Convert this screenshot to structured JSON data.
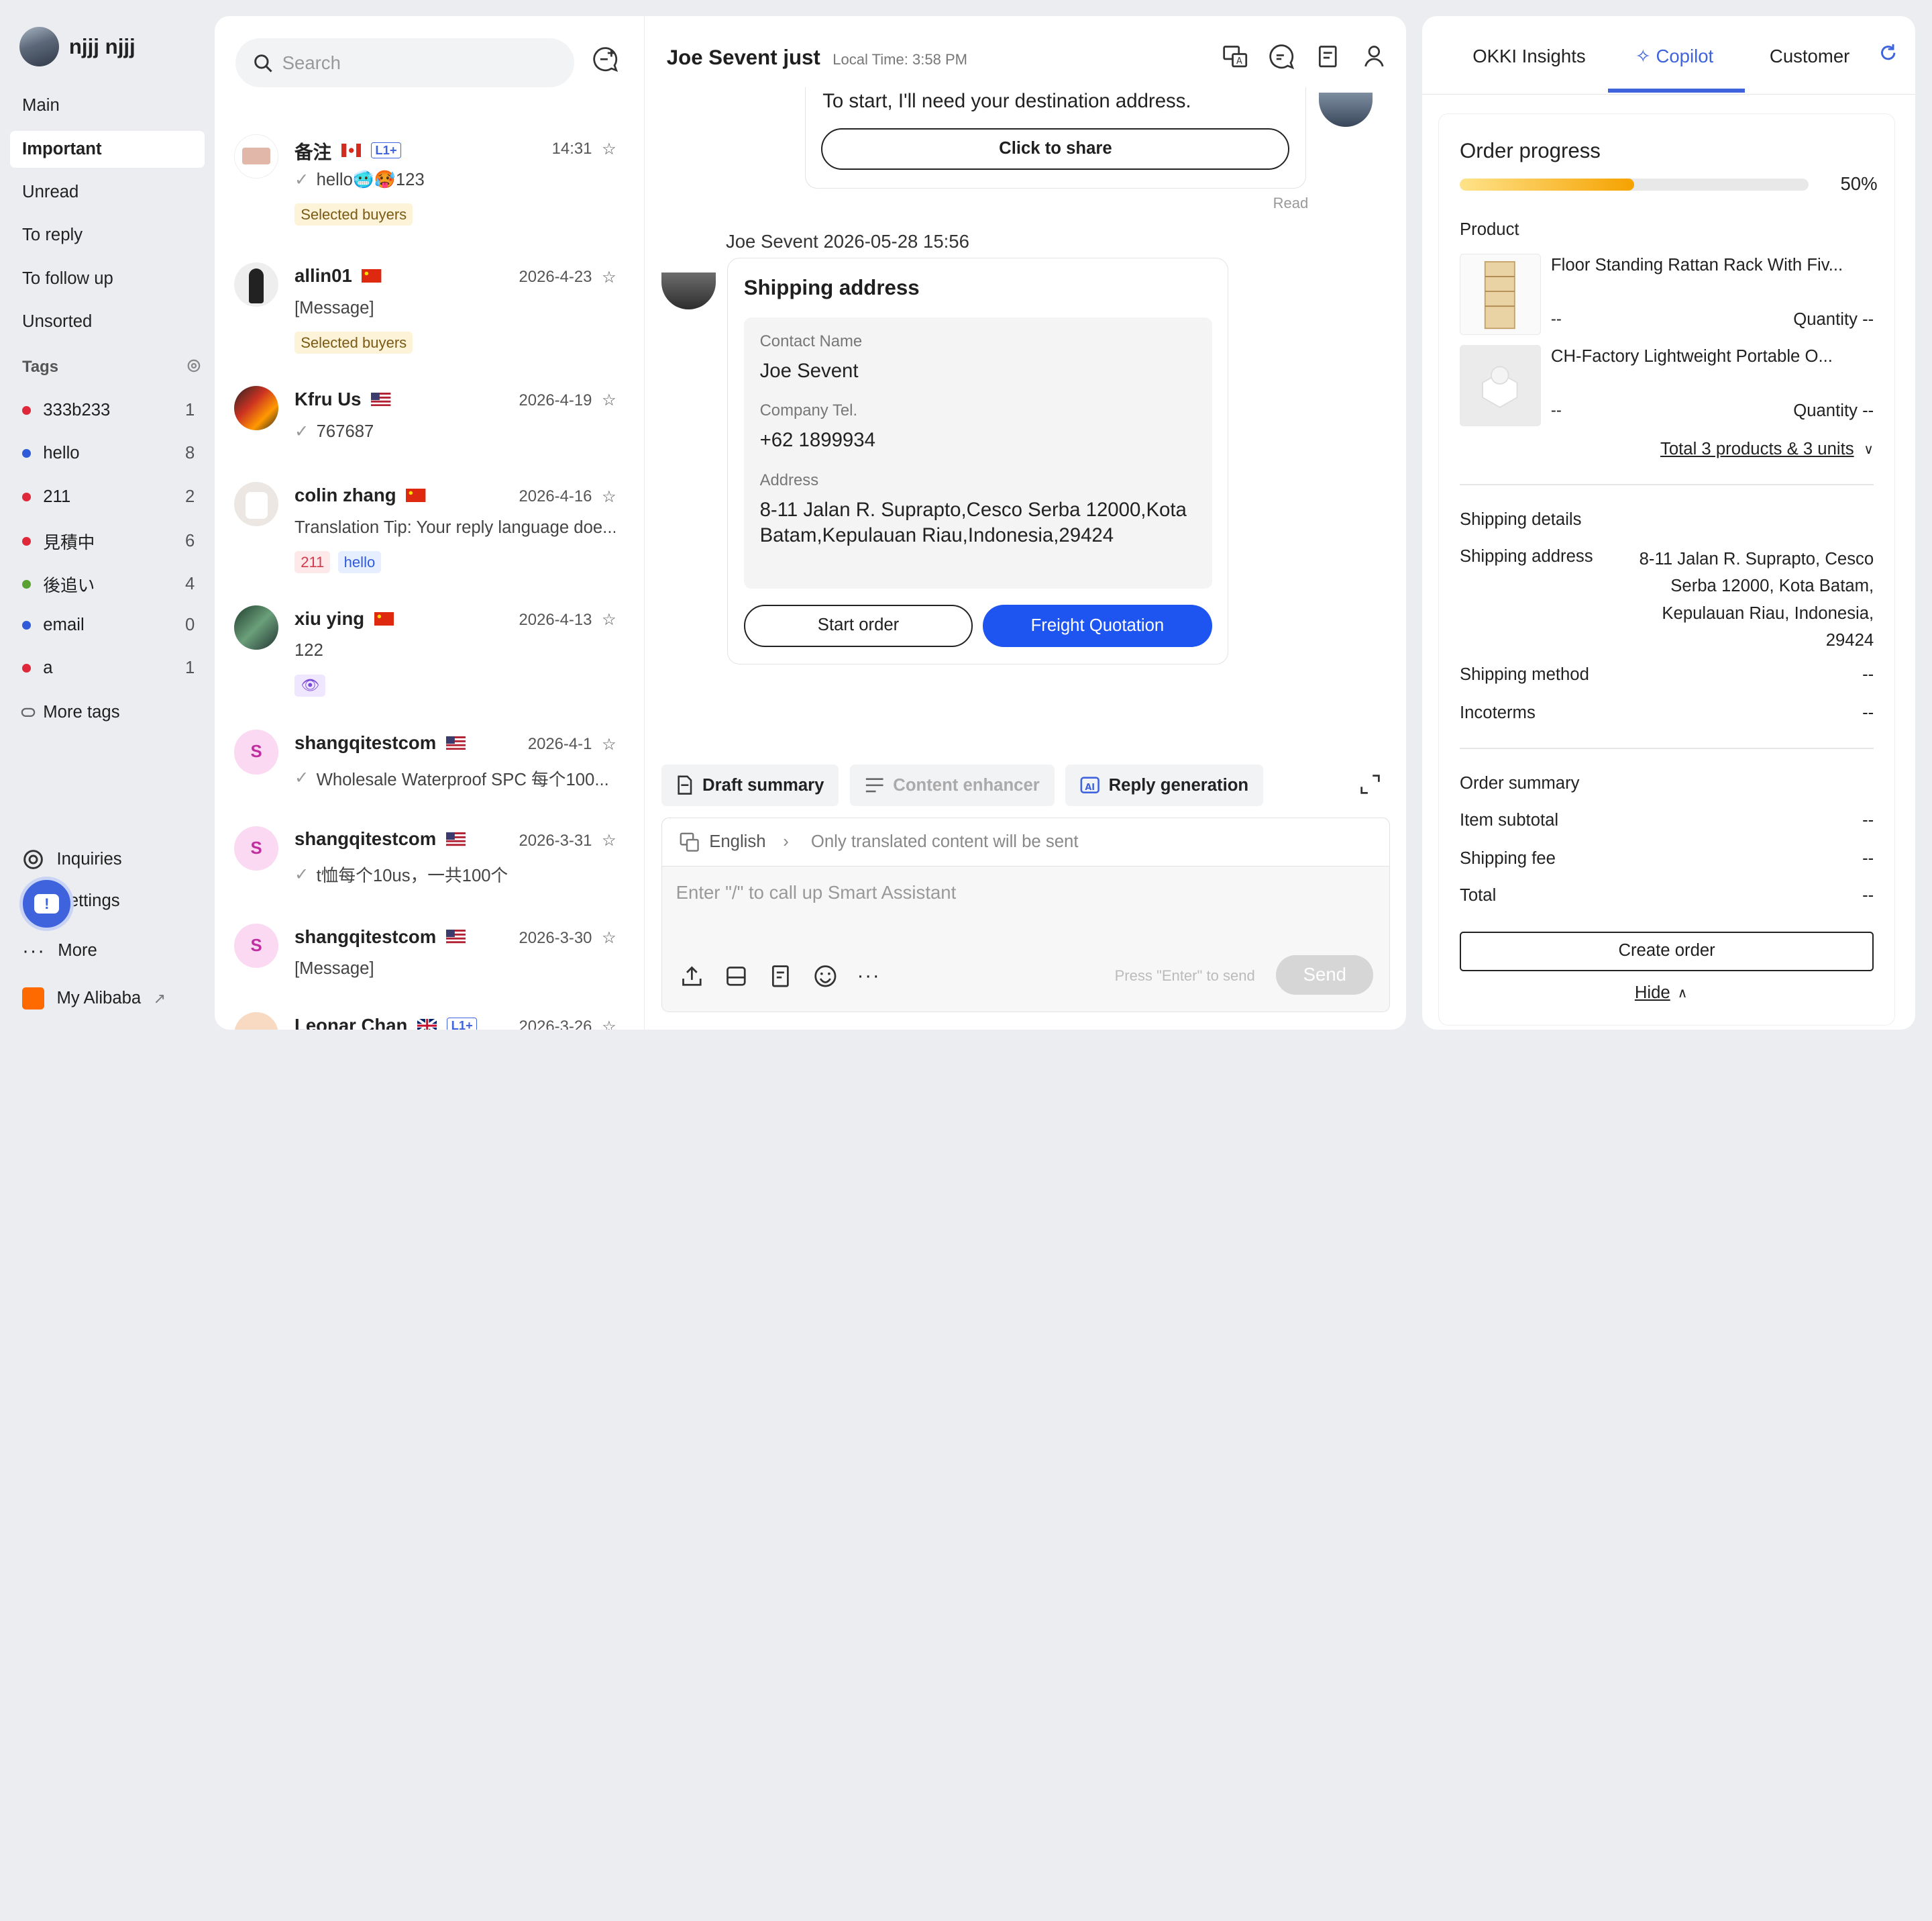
{
  "user": {
    "name": "njjj njjj"
  },
  "nav": {
    "items": [
      {
        "label": "Main",
        "active": false
      },
      {
        "label": "Important",
        "active": true
      },
      {
        "label": "Unread",
        "active": false
      },
      {
        "label": "To reply",
        "active": false
      },
      {
        "label": "To follow up",
        "active": false
      },
      {
        "label": "Unsorted",
        "active": false
      }
    ],
    "tags_title": "Tags",
    "tags": [
      {
        "label": "333b233",
        "count": "1",
        "color": "#e0283b"
      },
      {
        "label": "hello",
        "count": "8",
        "color": "#2f5bd8"
      },
      {
        "label": "211",
        "count": "2",
        "color": "#e0283b"
      },
      {
        "label": "見積中",
        "count": "6",
        "color": "#e0283b"
      },
      {
        "label": "後追い",
        "count": "4",
        "color": "#5aa132"
      },
      {
        "label": "email",
        "count": "0",
        "color": "#2f5bd8"
      },
      {
        "label": "a",
        "count": "1",
        "color": "#e0283b"
      }
    ],
    "more_tags": "More tags",
    "inquiries": "Inquiries",
    "settings": "ettings",
    "more": "More",
    "my_alibaba": "My Alibaba"
  },
  "conversations": {
    "search_placeholder": "Search",
    "items": [
      {
        "name": "备注",
        "flag": "ca",
        "level": "L1+",
        "time": "14:31",
        "message": "hello🥶🥵123",
        "read": true,
        "chips": [
          {
            "text": "Selected buyers",
            "kind": "sel"
          }
        ]
      },
      {
        "name": "allin01",
        "flag": "cn",
        "level": "",
        "time": "2026-4-23",
        "message": "[Message]",
        "read": false,
        "chips": [
          {
            "text": "Selected buyers",
            "kind": "sel"
          }
        ]
      },
      {
        "name": "Kfru Us",
        "flag": "us",
        "level": "",
        "time": "2026-4-19",
        "message": "767687",
        "read": true,
        "chips": []
      },
      {
        "name": "colin zhang",
        "flag": "cn",
        "level": "",
        "time": "2026-4-16",
        "message": "Translation Tip: Your reply language doe...",
        "read": false,
        "chips": [
          {
            "text": "211",
            "kind": "red"
          },
          {
            "text": "hello",
            "kind": "blue"
          }
        ]
      },
      {
        "name": "xiu ying",
        "flag": "cn",
        "level": "",
        "time": "2026-4-13",
        "message": "122",
        "read": false,
        "chips": []
      },
      {
        "name": "shangqitestcom",
        "flag": "us",
        "level": "",
        "time": "2026-4-1",
        "message": "Wholesale Waterproof SPC 每个100...",
        "read": true,
        "chips": []
      },
      {
        "name": "shangqitestcom",
        "flag": "us",
        "level": "",
        "time": "2026-3-31",
        "message": "t恤每个10us，一共100个",
        "read": true,
        "chips": []
      },
      {
        "name": "shangqitestcom",
        "flag": "us",
        "level": "",
        "time": "2026-3-30",
        "message": "[Message]",
        "read": false,
        "chips": []
      },
      {
        "name": "Leonar Chan",
        "flag": "gb",
        "level": "L1+",
        "time": "2026-3-26",
        "message": "",
        "read": false,
        "chips": []
      }
    ]
  },
  "chat": {
    "title": "Joe Sevent just",
    "local_time": "Local Time: 3:58 PM",
    "prev_message": "To start, I'll need your destination address.",
    "share_button": "Click to share",
    "read_status": "Read",
    "sender_line": "Joe Sevent   2026-05-28 15:56",
    "card": {
      "title": "Shipping address",
      "contact_label": "Contact Name",
      "contact_value": "Joe Sevent",
      "tel_label": "Company Tel.",
      "tel_value": "+62 1899934",
      "address_label": "Address",
      "address_value": "8-11 Jalan R. Suprapto,Cesco Serba 12000,Kota Batam,Kepulauan Riau,Indonesia,29424",
      "start_order": "Start order",
      "freight_quotation": "Freight Quotation"
    },
    "tools": {
      "draft_summary": "Draft summary",
      "content_enhancer": "Content enhancer",
      "reply_generation": "Reply generation"
    },
    "composer": {
      "language": "English",
      "translate_note": "Only translated content will be sent",
      "placeholder": "Enter \"/\" to call up Smart Assistant",
      "send_hint": "Press \"Enter\" to send",
      "send": "Send"
    }
  },
  "right_panel": {
    "tabs": [
      {
        "label": "OKKI Insights",
        "active": false
      },
      {
        "label": "Copilot",
        "active": true
      },
      {
        "label": "Customer",
        "active": false
      }
    ],
    "order_progress_title": "Order progress",
    "progress": 0.5,
    "progress_label": "50%",
    "product_title": "Product",
    "products": [
      {
        "name": "Floor Standing Rattan Rack With Fiv...",
        "price": "--",
        "quantity": "Quantity --"
      },
      {
        "name": "CH-Factory Lightweight Portable O...",
        "price": "--",
        "quantity": "Quantity --"
      }
    ],
    "total_products": "Total 3 products & 3 units",
    "shipping_details_title": "Shipping details",
    "shipping_address_label": "Shipping address",
    "shipping_address_value": "8-11 Jalan R. Suprapto, Cesco Serba 12000, Kota Batam, Kepulauan Riau, Indonesia, 29424",
    "shipping_method_label": "Shipping method",
    "shipping_method_value": "--",
    "incoterms_label": "Incoterms",
    "incoterms_value": "--",
    "order_summary_title": "Order summary",
    "item_subtotal_label": "Item subtotal",
    "item_subtotal_value": "--",
    "shipping_fee_label": "Shipping fee",
    "shipping_fee_value": "--",
    "total_label": "Total",
    "total_value": "--",
    "create_order": "Create order",
    "hide": "Hide"
  },
  "colors": {
    "accent": "#3e63dd",
    "primary_button": "#1e55f0",
    "progress": "#f5a200"
  }
}
